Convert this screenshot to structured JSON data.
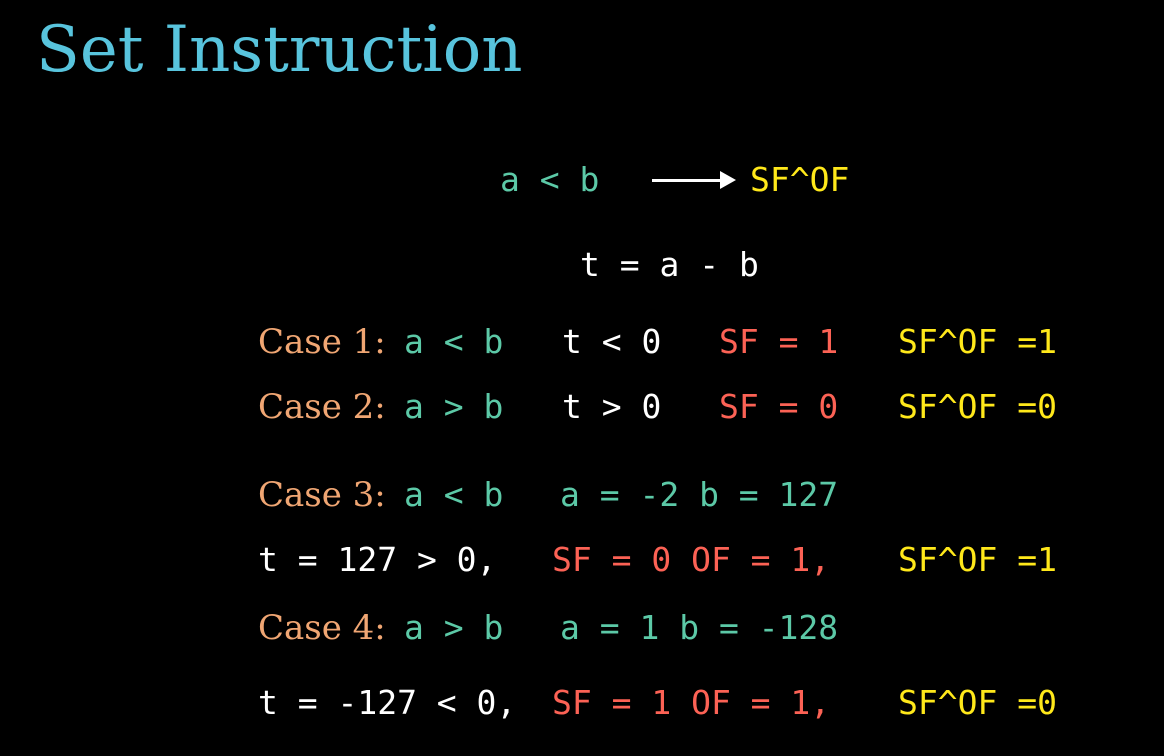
{
  "slide": {
    "title": "Set Instruction",
    "condition": {
      "lhs": "a < b",
      "rhs": "SF^OF"
    },
    "definition": "t = a - b",
    "case1": {
      "label": "Case 1:",
      "relation": "a < b",
      "t_expr": "t < 0",
      "sf": "SF = 1",
      "result": "SF^OF =1"
    },
    "case2": {
      "label": "Case 2:",
      "relation": "a > b",
      "t_expr": "t > 0",
      "sf": "SF = 0",
      "result": "SF^OF =0"
    },
    "case3": {
      "label": "Case 3:",
      "relation": "a < b",
      "values": "a = -2 b = 127",
      "t_expr": "t = 127 > 0,",
      "flags": "SF = 0 OF = 1,",
      "result": "SF^OF =1"
    },
    "case4": {
      "label": "Case 4:",
      "relation": "a > b",
      "values": "a = 1 b = -128",
      "t_expr": "t = -127 < 0,",
      "flags": "SF = 1 OF = 1,",
      "result": "SF^OF =0"
    },
    "colors": {
      "background": "#000000",
      "title": "#58c4dd",
      "teal": "#5cc9a7",
      "white": "#ffffff",
      "red": "#fc6255",
      "yellow": "#ffe81a",
      "orange": "#f0a673"
    }
  }
}
